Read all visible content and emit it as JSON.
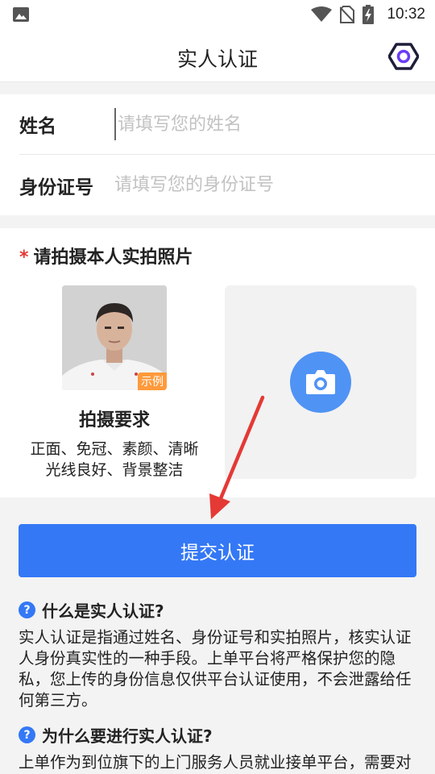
{
  "status_bar": {
    "time": "10:32",
    "icons": [
      "image-icon",
      "wifi-icon",
      "no-sim-icon",
      "battery-charging-icon"
    ]
  },
  "header": {
    "title": "实人认证",
    "settings_icon": "hexagon-settings-icon"
  },
  "form": {
    "name_label": "姓名",
    "name_placeholder": "请填写您的姓名",
    "id_label": "身份证号",
    "id_placeholder": "请填写您的身份证号"
  },
  "photo": {
    "required_mark": "*",
    "title": "请拍摄本人实拍照片",
    "sample_tag": "示例",
    "requirements_title": "拍摄要求",
    "requirements_line1": "正面、免冠、素颜、清晰",
    "requirements_line2": "光线良好、背景整洁",
    "upload_icon": "camera-icon"
  },
  "submit_label": "提交认证",
  "faq": [
    {
      "icon": "?",
      "question": "什么是实人认证?",
      "answer": "实人认证是指通过姓名、身份证号和实拍照片，核实认证人身份真实性的一种手段。上单平台将严格保护您的隐私，您上传的身份信息仅供平台认证使用，不会泄露给任何第三方。"
    },
    {
      "icon": "?",
      "question": "为什么要进行实人认证?",
      "answer": "上单作为到位旗下的上门服务人员就业接单平台，需要对服务人员身份进行核实，以确保服务安全。"
    }
  ],
  "colors": {
    "primary": "#3478f6",
    "required": "#e53935",
    "sample_tag": "#ff9a3c",
    "annotation_arrow": "#e53935"
  }
}
